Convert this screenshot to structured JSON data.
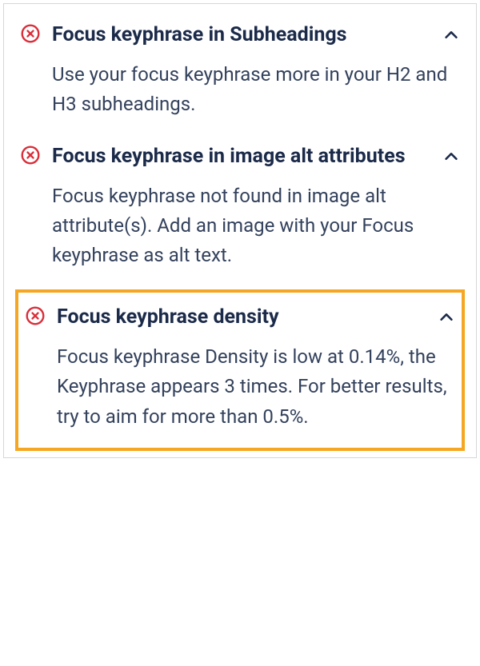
{
  "checks": [
    {
      "title": "Focus keyphrase in Subheadings",
      "description": "Use your focus keyphrase more in your H2 and H3 subheadings.",
      "status": "error",
      "highlighted": false
    },
    {
      "title": "Focus keyphrase in image alt attributes",
      "description": "Focus keyphrase not found in image alt attribute(s). Add an image with your Focus keyphrase as alt text.",
      "status": "error",
      "highlighted": false
    },
    {
      "title": "Focus keyphrase density",
      "description": "Focus keyphrase Density is low at 0.14%, the Keyphrase appears 3 times. For better results, try to aim for more than 0.5%.",
      "status": "error",
      "highlighted": true
    }
  ],
  "colors": {
    "error": "#d92e3a",
    "text": "#1b2a49",
    "highlight": "#f5a623"
  }
}
